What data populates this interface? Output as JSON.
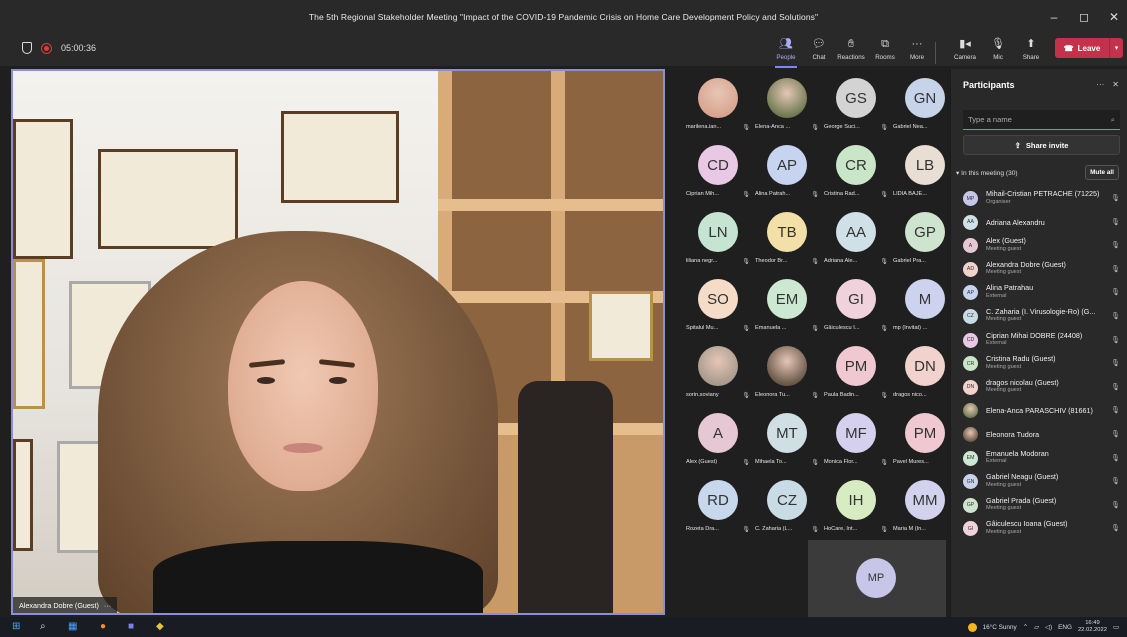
{
  "window": {
    "title": "The 5th Regional Stakeholder Meeting \"Impact of the COVID-19 Pandemic Crisis on Home Care Development Policy and Solutions\"",
    "minimize": "–",
    "maximize": "◻",
    "close": "✕"
  },
  "toolbar": {
    "timer": "05:00:36",
    "people": "People",
    "chat": "Chat",
    "reactions": "Reactions",
    "rooms": "Rooms",
    "more": "More",
    "camera": "Camera",
    "mic": "Mic",
    "share": "Share",
    "leave": "Leave"
  },
  "main_video": {
    "name": "Alexandra Dobre (Guest)",
    "more": "···"
  },
  "gallery": [
    {
      "initials": "",
      "name": "marilena.ian...",
      "photo": true,
      "color": "#d9a48f"
    },
    {
      "initials": "",
      "name": "Elena-Anca ...",
      "photo": true,
      "color": "#6f7b52"
    },
    {
      "initials": "GS",
      "name": "George Suci...",
      "photo": false,
      "color": "#d3d3d3"
    },
    {
      "initials": "GN",
      "name": "Gabriel Nea...",
      "photo": false,
      "color": "#c7d3e8"
    },
    {
      "initials": "CD",
      "name": "Ciprian Mih...",
      "photo": false,
      "color": "#e8c8e4"
    },
    {
      "initials": "AP",
      "name": "Alina Patrah...",
      "photo": false,
      "color": "#c6d4f0"
    },
    {
      "initials": "CR",
      "name": "Cristina Rad...",
      "photo": false,
      "color": "#c9e6c9"
    },
    {
      "initials": "LB",
      "name": "LIDIA BAJE...",
      "photo": false,
      "color": "#e9ded4"
    },
    {
      "initials": "LN",
      "name": "liliana negr...",
      "photo": false,
      "color": "#c5e4d1"
    },
    {
      "initials": "TB",
      "name": "Theodor Br...",
      "photo": false,
      "color": "#f2e0a8"
    },
    {
      "initials": "AA",
      "name": "Adriana Ale...",
      "photo": false,
      "color": "#cfe0e6"
    },
    {
      "initials": "GP",
      "name": "Gabriel Pra...",
      "photo": false,
      "color": "#cfe4cf"
    },
    {
      "initials": "SO",
      "name": "Spitalul Mu...",
      "photo": false,
      "color": "#f4dcc8"
    },
    {
      "initials": "EM",
      "name": "Emanuela ...",
      "photo": false,
      "color": "#cce8d2"
    },
    {
      "initials": "GI",
      "name": "Gâiculescu I...",
      "photo": false,
      "color": "#efd2dc"
    },
    {
      "initials": "M",
      "name": "mp (Invitat) ...",
      "photo": false,
      "color": "#cdd3ee"
    },
    {
      "initials": "",
      "name": "sorin.soviany",
      "photo": true,
      "color": "#a89a8c"
    },
    {
      "initials": "",
      "name": "Eleonora Tu...",
      "photo": true,
      "color": "#6a5848"
    },
    {
      "initials": "PM",
      "name": "Paula Badin...",
      "photo": false,
      "color": "#f0c8d2"
    },
    {
      "initials": "DN",
      "name": "dragos nico...",
      "photo": false,
      "color": "#f2d2cc"
    },
    {
      "initials": "A",
      "name": "Alex (Guest)",
      "photo": false,
      "color": "#e6c8d4"
    },
    {
      "initials": "MT",
      "name": "Mihaela To...",
      "photo": false,
      "color": "#cfdfe3"
    },
    {
      "initials": "MF",
      "name": "Monica Flor...",
      "photo": false,
      "color": "#d6d0ef"
    },
    {
      "initials": "PM",
      "name": "Pavel Mures...",
      "photo": false,
      "color": "#f0c8d2"
    },
    {
      "initials": "RD",
      "name": "Rozeta Dra...",
      "photo": false,
      "color": "#c8d8ec"
    },
    {
      "initials": "CZ",
      "name": "C. Zaharia (L...",
      "photo": false,
      "color": "#c9dce6"
    },
    {
      "initials": "IH",
      "name": "HoCare, Int...",
      "photo": false,
      "color": "#d8ecc4"
    },
    {
      "initials": "MM",
      "name": "Maria M (In...",
      "photo": false,
      "color": "#d2d2ee"
    }
  ],
  "self_tile": {
    "initials": "MP"
  },
  "panel": {
    "title": "Participants",
    "more": "···",
    "close": "✕",
    "search_placeholder": "Type a name",
    "share_invite": "Share invite",
    "in_meeting": "In this meeting (30)",
    "mute_all": "Mute all",
    "participants": [
      {
        "initials": "MP",
        "name": "Mihail-Cristian PETRACHE (71225)",
        "role": "Organiser",
        "color": "#c8c6e8"
      },
      {
        "initials": "AA",
        "name": "Adriana Alexandru",
        "role": "",
        "color": "#cfe0e6"
      },
      {
        "initials": "A",
        "name": "Alex (Guest)",
        "role": "Meeting guest",
        "color": "#e6c8d4"
      },
      {
        "initials": "AD",
        "name": "Alexandra Dobre (Guest)",
        "role": "Meeting guest",
        "color": "#f2d2cc"
      },
      {
        "initials": "AP",
        "name": "Alina Patrahau",
        "role": "External",
        "color": "#c6d4f0"
      },
      {
        "initials": "CZ",
        "name": "C. Zaharia (I. Virusologie-Ro) (G...",
        "role": "Meeting guest",
        "color": "#c9dce6"
      },
      {
        "initials": "CD",
        "name": "Ciprian Mihai DOBRE (24408)",
        "role": "External",
        "color": "#e8c8e4"
      },
      {
        "initials": "CR",
        "name": "Cristina Radu (Guest)",
        "role": "Meeting guest",
        "color": "#c9e6c9"
      },
      {
        "initials": "DN",
        "name": "dragos nicolau (Guest)",
        "role": "Meeting guest",
        "color": "#f2d2cc"
      },
      {
        "initials": "",
        "name": "Elena-Anca PARASCHIV (81661)",
        "role": "",
        "color": "#6f7b52"
      },
      {
        "initials": "",
        "name": "Eleonora Tudora",
        "role": "",
        "color": "#6a5848"
      },
      {
        "initials": "EM",
        "name": "Emanuela Modoran",
        "role": "External",
        "color": "#cce8d2"
      },
      {
        "initials": "GN",
        "name": "Gabriel Neagu (Guest)",
        "role": "Meeting guest",
        "color": "#c7d3e8"
      },
      {
        "initials": "GP",
        "name": "Gabriel Prada (Guest)",
        "role": "Meeting guest",
        "color": "#cfe4cf"
      },
      {
        "initials": "GI",
        "name": "Gâiculescu Ioana (Guest)",
        "role": "Meeting guest",
        "color": "#efd2dc"
      }
    ]
  },
  "taskbar": {
    "weather": "16°C Sunny",
    "lang": "ENG",
    "time": "16:49",
    "date": "22.02.2022"
  },
  "colors": {
    "accent": "#7f85f5",
    "leave": "#c4314b",
    "background": "#1f1f1f",
    "panel": "#292929"
  }
}
